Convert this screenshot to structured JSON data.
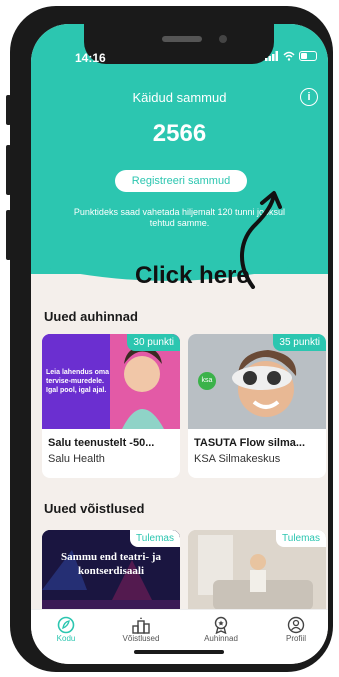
{
  "status": {
    "time": "14:16"
  },
  "hero": {
    "title": "Käidud sammud",
    "steps": "2566",
    "register_label": "Registreeri sammud",
    "note": "Punktideks saad vahetada hiljemalt 120 tunni jooksul tehtud samme.",
    "info_label": "i"
  },
  "annotation": {
    "text": "Click here"
  },
  "rewards": {
    "title": "Uued auhinnad",
    "items": [
      {
        "badge": "30 punkti",
        "name": "Salu teenustelt -50...",
        "provider": "Salu Health",
        "img_text": "Leia lahendus oma tervise-muredele. Igal pool, igal ajal."
      },
      {
        "badge": "35 punkti",
        "name": "TASUTA Flow silma...",
        "provider": "KSA Silmakeskus",
        "logo": "ksa"
      }
    ]
  },
  "contests": {
    "title": "Uued võistlused",
    "items": [
      {
        "badge": "Tulemas",
        "img_text": "Sammu end teatri- ja kontserdisaali"
      },
      {
        "badge": "Tulemas"
      }
    ]
  },
  "tabs": [
    {
      "label": "Kodu",
      "icon": "home-icon",
      "active": true
    },
    {
      "label": "Võistlused",
      "icon": "trophy-icon",
      "active": false
    },
    {
      "label": "Auhinnad",
      "icon": "award-icon",
      "active": false
    },
    {
      "label": "Profiil",
      "icon": "profile-icon",
      "active": false
    }
  ],
  "colors": {
    "accent": "#2cc6b0",
    "background": "#f4efeb"
  }
}
